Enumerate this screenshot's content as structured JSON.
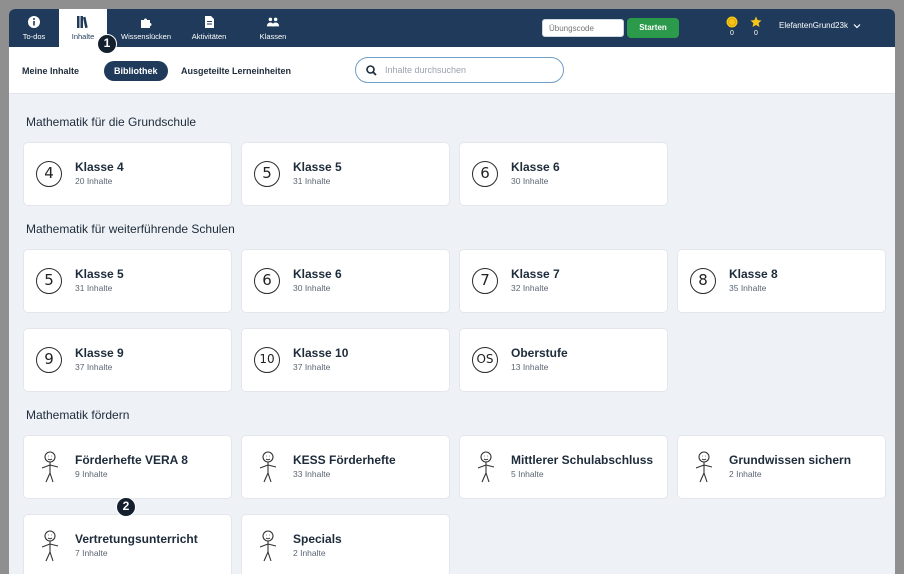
{
  "topbar": {
    "nav": [
      {
        "label": "To-dos",
        "icon": "info-icon"
      },
      {
        "label": "Inhalte",
        "icon": "library-icon"
      },
      {
        "label": "Wissenslücken",
        "icon": "puzzle-icon"
      },
      {
        "label": "Aktivitäten",
        "icon": "document-icon"
      },
      {
        "label": "Klassen",
        "icon": "people-icon"
      }
    ],
    "code_placeholder": "Übungscode",
    "start_label": "Starten",
    "coins": "0",
    "stars": "0",
    "username": "ElefantenGrund23k"
  },
  "subnav": {
    "tabs": [
      "Meine Inhalte",
      "Bibliothek",
      "Ausgeteilte Lerneinheiten"
    ],
    "active_tab": "Bibliothek",
    "search_placeholder": "Inhalte durchsuchen"
  },
  "badges": [
    "1",
    "2"
  ],
  "sections": [
    {
      "title": "Mathematik für die Grundschule",
      "cards": [
        {
          "badge": "4",
          "title": "Klasse 4",
          "sub": "20 Inhalte"
        },
        {
          "badge": "5",
          "title": "Klasse 5",
          "sub": "31 Inhalte"
        },
        {
          "badge": "6",
          "title": "Klasse 6",
          "sub": "30 Inhalte"
        }
      ]
    },
    {
      "title": "Mathematik für weiterführende Schulen",
      "cards": [
        {
          "badge": "5",
          "title": "Klasse 5",
          "sub": "31 Inhalte"
        },
        {
          "badge": "6",
          "title": "Klasse 6",
          "sub": "30 Inhalte"
        },
        {
          "badge": "7",
          "title": "Klasse 7",
          "sub": "32 Inhalte"
        },
        {
          "badge": "8",
          "title": "Klasse 8",
          "sub": "35 Inhalte"
        },
        {
          "badge": "9",
          "title": "Klasse 9",
          "sub": "37 Inhalte"
        },
        {
          "badge": "10",
          "title": "Klasse 10",
          "sub": "37 Inhalte"
        },
        {
          "badge": "OS",
          "title": "Oberstufe",
          "sub": "13 Inhalte"
        }
      ]
    },
    {
      "title": "Mathematik fördern",
      "cards": [
        {
          "title": "Förderhefte VERA 8",
          "sub": "9 Inhalte"
        },
        {
          "title": "KESS Förderhefte",
          "sub": "33 Inhalte"
        },
        {
          "title": "Mittlerer Schulabschluss",
          "sub": "5 Inhalte"
        },
        {
          "title": "Grundwissen sichern",
          "sub": "2 Inhalte"
        },
        {
          "title": "Vertretungsunterricht",
          "sub": "7 Inhalte"
        },
        {
          "title": "Specials",
          "sub": "2 Inhalte"
        }
      ]
    }
  ]
}
